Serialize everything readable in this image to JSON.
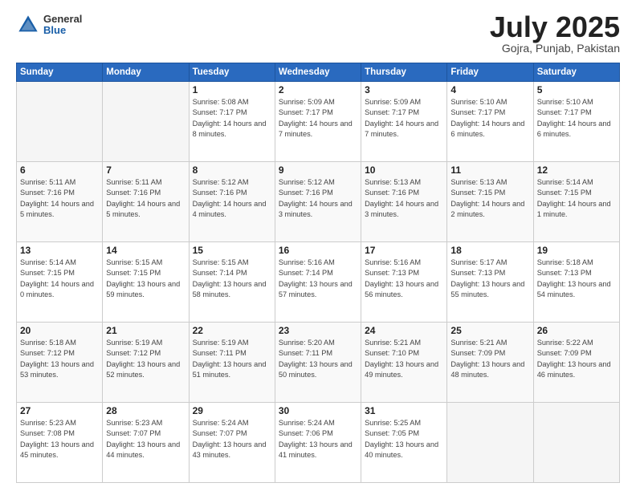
{
  "header": {
    "logo_general": "General",
    "logo_blue": "Blue",
    "month": "July 2025",
    "location": "Gojra, Punjab, Pakistan"
  },
  "weekdays": [
    "Sunday",
    "Monday",
    "Tuesday",
    "Wednesday",
    "Thursday",
    "Friday",
    "Saturday"
  ],
  "weeks": [
    [
      {
        "day": "",
        "info": ""
      },
      {
        "day": "",
        "info": ""
      },
      {
        "day": "1",
        "info": "Sunrise: 5:08 AM\nSunset: 7:17 PM\nDaylight: 14 hours\nand 8 minutes."
      },
      {
        "day": "2",
        "info": "Sunrise: 5:09 AM\nSunset: 7:17 PM\nDaylight: 14 hours\nand 7 minutes."
      },
      {
        "day": "3",
        "info": "Sunrise: 5:09 AM\nSunset: 7:17 PM\nDaylight: 14 hours\nand 7 minutes."
      },
      {
        "day": "4",
        "info": "Sunrise: 5:10 AM\nSunset: 7:17 PM\nDaylight: 14 hours\nand 6 minutes."
      },
      {
        "day": "5",
        "info": "Sunrise: 5:10 AM\nSunset: 7:17 PM\nDaylight: 14 hours\nand 6 minutes."
      }
    ],
    [
      {
        "day": "6",
        "info": "Sunrise: 5:11 AM\nSunset: 7:16 PM\nDaylight: 14 hours\nand 5 minutes."
      },
      {
        "day": "7",
        "info": "Sunrise: 5:11 AM\nSunset: 7:16 PM\nDaylight: 14 hours\nand 5 minutes."
      },
      {
        "day": "8",
        "info": "Sunrise: 5:12 AM\nSunset: 7:16 PM\nDaylight: 14 hours\nand 4 minutes."
      },
      {
        "day": "9",
        "info": "Sunrise: 5:12 AM\nSunset: 7:16 PM\nDaylight: 14 hours\nand 3 minutes."
      },
      {
        "day": "10",
        "info": "Sunrise: 5:13 AM\nSunset: 7:16 PM\nDaylight: 14 hours\nand 3 minutes."
      },
      {
        "day": "11",
        "info": "Sunrise: 5:13 AM\nSunset: 7:15 PM\nDaylight: 14 hours\nand 2 minutes."
      },
      {
        "day": "12",
        "info": "Sunrise: 5:14 AM\nSunset: 7:15 PM\nDaylight: 14 hours\nand 1 minute."
      }
    ],
    [
      {
        "day": "13",
        "info": "Sunrise: 5:14 AM\nSunset: 7:15 PM\nDaylight: 14 hours\nand 0 minutes."
      },
      {
        "day": "14",
        "info": "Sunrise: 5:15 AM\nSunset: 7:15 PM\nDaylight: 13 hours\nand 59 minutes."
      },
      {
        "day": "15",
        "info": "Sunrise: 5:15 AM\nSunset: 7:14 PM\nDaylight: 13 hours\nand 58 minutes."
      },
      {
        "day": "16",
        "info": "Sunrise: 5:16 AM\nSunset: 7:14 PM\nDaylight: 13 hours\nand 57 minutes."
      },
      {
        "day": "17",
        "info": "Sunrise: 5:16 AM\nSunset: 7:13 PM\nDaylight: 13 hours\nand 56 minutes."
      },
      {
        "day": "18",
        "info": "Sunrise: 5:17 AM\nSunset: 7:13 PM\nDaylight: 13 hours\nand 55 minutes."
      },
      {
        "day": "19",
        "info": "Sunrise: 5:18 AM\nSunset: 7:13 PM\nDaylight: 13 hours\nand 54 minutes."
      }
    ],
    [
      {
        "day": "20",
        "info": "Sunrise: 5:18 AM\nSunset: 7:12 PM\nDaylight: 13 hours\nand 53 minutes."
      },
      {
        "day": "21",
        "info": "Sunrise: 5:19 AM\nSunset: 7:12 PM\nDaylight: 13 hours\nand 52 minutes."
      },
      {
        "day": "22",
        "info": "Sunrise: 5:19 AM\nSunset: 7:11 PM\nDaylight: 13 hours\nand 51 minutes."
      },
      {
        "day": "23",
        "info": "Sunrise: 5:20 AM\nSunset: 7:11 PM\nDaylight: 13 hours\nand 50 minutes."
      },
      {
        "day": "24",
        "info": "Sunrise: 5:21 AM\nSunset: 7:10 PM\nDaylight: 13 hours\nand 49 minutes."
      },
      {
        "day": "25",
        "info": "Sunrise: 5:21 AM\nSunset: 7:09 PM\nDaylight: 13 hours\nand 48 minutes."
      },
      {
        "day": "26",
        "info": "Sunrise: 5:22 AM\nSunset: 7:09 PM\nDaylight: 13 hours\nand 46 minutes."
      }
    ],
    [
      {
        "day": "27",
        "info": "Sunrise: 5:23 AM\nSunset: 7:08 PM\nDaylight: 13 hours\nand 45 minutes."
      },
      {
        "day": "28",
        "info": "Sunrise: 5:23 AM\nSunset: 7:07 PM\nDaylight: 13 hours\nand 44 minutes."
      },
      {
        "day": "29",
        "info": "Sunrise: 5:24 AM\nSunset: 7:07 PM\nDaylight: 13 hours\nand 43 minutes."
      },
      {
        "day": "30",
        "info": "Sunrise: 5:24 AM\nSunset: 7:06 PM\nDaylight: 13 hours\nand 41 minutes."
      },
      {
        "day": "31",
        "info": "Sunrise: 5:25 AM\nSunset: 7:05 PM\nDaylight: 13 hours\nand 40 minutes."
      },
      {
        "day": "",
        "info": ""
      },
      {
        "day": "",
        "info": ""
      }
    ]
  ]
}
